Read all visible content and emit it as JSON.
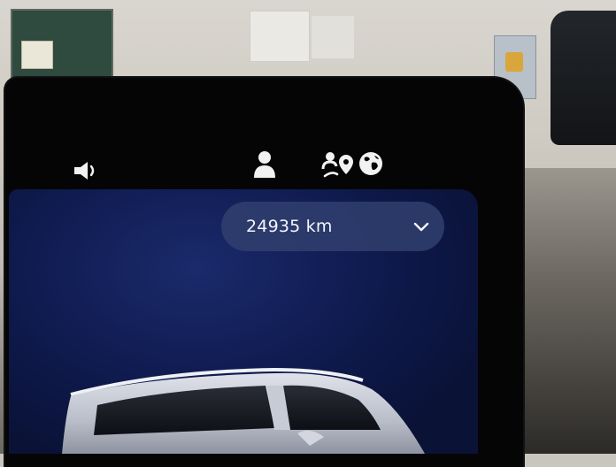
{
  "status_bar": {
    "icons": [
      "speaker-icon",
      "person-icon",
      "navigation-person-icon",
      "globe-icon"
    ]
  },
  "odometer": {
    "value": "24935 km",
    "dropdown_icon": "chevron-down-icon"
  },
  "colors": {
    "panel_background": "#0f1a4e",
    "pill_background": "#30406e",
    "text": "#f4f6fb"
  }
}
